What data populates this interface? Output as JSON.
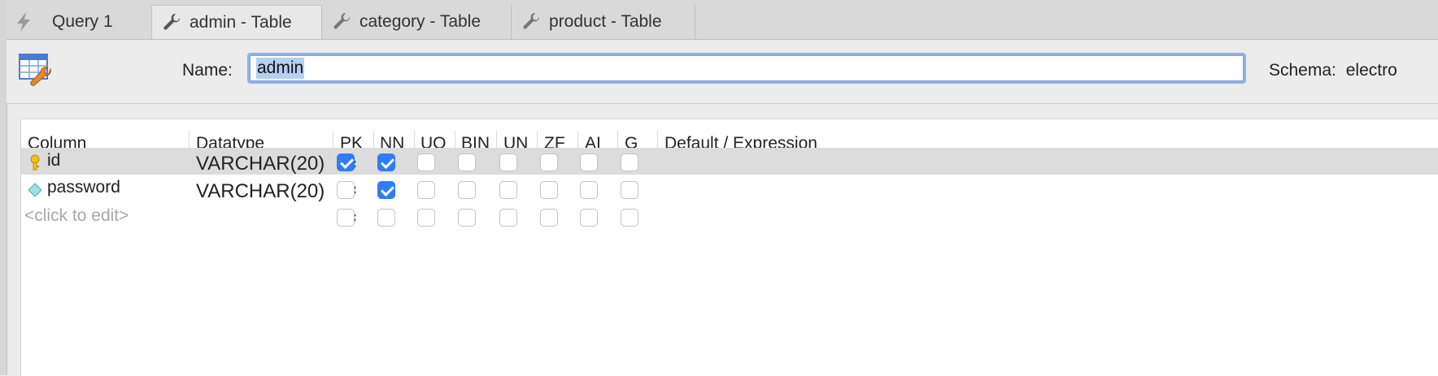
{
  "tabs": [
    {
      "label": "Query 1",
      "icon": "lightning-icon",
      "active": false
    },
    {
      "label": "admin - Table",
      "icon": "wrench-icon",
      "active": true
    },
    {
      "label": "category - Table",
      "icon": "wrench-icon",
      "active": false
    },
    {
      "label": "product - Table",
      "icon": "wrench-icon",
      "active": false
    }
  ],
  "header": {
    "name_label": "Name:",
    "name_value": "admin",
    "schema_label": "Schema:",
    "schema_value": "electro"
  },
  "columns": {
    "headers": [
      "Column",
      "Datatype",
      "PK",
      "NN",
      "UQ",
      "BIN",
      "UN",
      "ZF",
      "AI",
      "G",
      "Default / Expression"
    ],
    "rows": [
      {
        "name": "id",
        "icon": "key-icon",
        "datatype": "VARCHAR(20)",
        "PK": true,
        "NN": true,
        "UQ": false,
        "BIN": false,
        "UN": false,
        "ZF": false,
        "AI": false,
        "G": false,
        "selected": true
      },
      {
        "name": "password",
        "icon": "diamond-icon",
        "datatype": "VARCHAR(20)",
        "PK": false,
        "NN": true,
        "UQ": false,
        "BIN": false,
        "UN": false,
        "ZF": false,
        "AI": false,
        "G": false,
        "selected": false
      }
    ],
    "new_row_placeholder": "<click to edit>"
  },
  "colors": {
    "checkbox_checked": "#2f7cf6",
    "selected_row": "#dcdcdc",
    "input_focus": "#93b0e6"
  }
}
